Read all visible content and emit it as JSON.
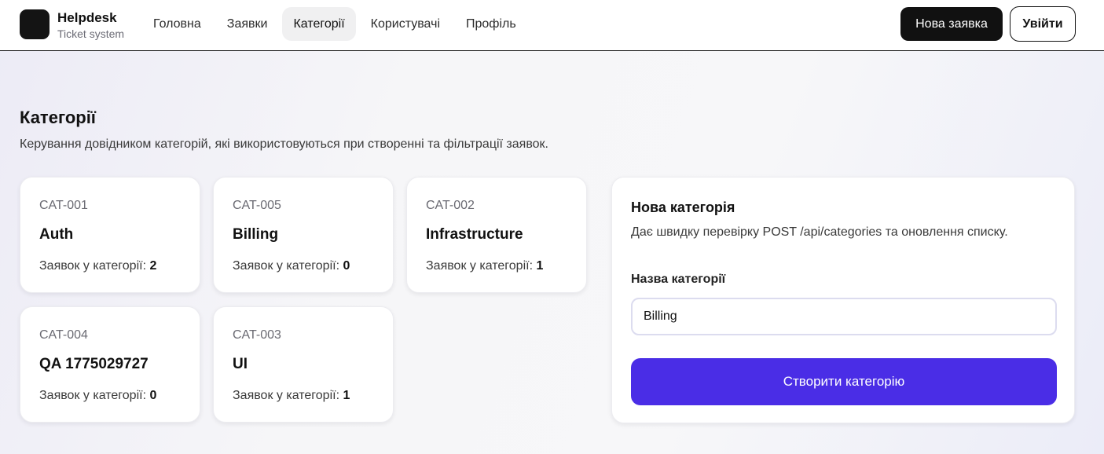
{
  "header": {
    "brand_name": "Helpdesk",
    "brand_sub": "Ticket system",
    "nav": [
      {
        "label": "Головна"
      },
      {
        "label": "Заявки"
      },
      {
        "label": "Категорії",
        "active": true
      },
      {
        "label": "Користувачі"
      },
      {
        "label": "Профіль"
      }
    ],
    "new_ticket_label": "Нова заявка",
    "login_label": "Увійти"
  },
  "page": {
    "title": "Категорії",
    "subtitle": "Керування довідником категорій, які використовуються при створенні та фільтрації заявок."
  },
  "categories": [
    {
      "code": "CAT-001",
      "name": "Auth",
      "count_label": "Заявок у категорії:",
      "count": "2"
    },
    {
      "code": "CAT-005",
      "name": "Billing",
      "count_label": "Заявок у категорії:",
      "count": "0"
    },
    {
      "code": "CAT-002",
      "name": "Infrastructure",
      "count_label": "Заявок у категорії:",
      "count": "1"
    },
    {
      "code": "CAT-004",
      "name": "QA 1775029727",
      "count_label": "Заявок у категорії:",
      "count": "0"
    },
    {
      "code": "CAT-003",
      "name": "UI",
      "count_label": "Заявок у категорії:",
      "count": "1"
    }
  ],
  "form": {
    "title": "Нова категорія",
    "description": "Дає швидку перевірку POST /api/categories та оновлення списку.",
    "field_label": "Назва категорії",
    "field_value": "Billing",
    "submit_label": "Створити категорію"
  },
  "colors": {
    "accent": "#4a2de6",
    "dark": "#111111"
  }
}
